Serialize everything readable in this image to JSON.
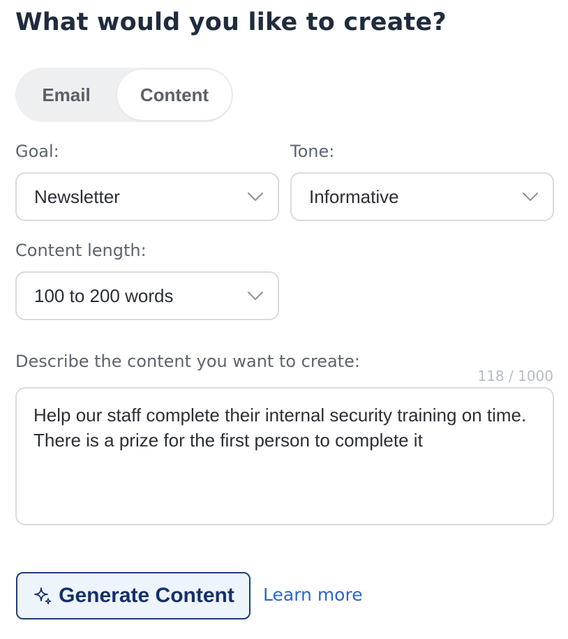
{
  "header": {
    "title": "What would you like to create?"
  },
  "toggle": {
    "options": [
      "Email",
      "Content"
    ],
    "selected": "Content"
  },
  "goal": {
    "label": "Goal:",
    "value": "Newsletter",
    "icon": "chevron-down-icon"
  },
  "tone": {
    "label": "Tone:",
    "value": "Informative",
    "icon": "chevron-down-icon"
  },
  "length": {
    "label": "Content length:",
    "value": "100 to 200 words",
    "icon": "chevron-down-icon"
  },
  "description": {
    "label": "Describe the content you want to create:",
    "counter": "118 / 1000",
    "value": "Help our staff complete their internal security training on time. There is a prize for the first person to complete it"
  },
  "actions": {
    "generate_label": "Generate Content",
    "generate_icon": "sparkle-icon",
    "learn_more": "Learn more"
  },
  "colors": {
    "title": "#1f2c3d",
    "accent": "#2a67c9",
    "button_border": "#1f3c7a",
    "button_bg": "#eef4fc"
  }
}
